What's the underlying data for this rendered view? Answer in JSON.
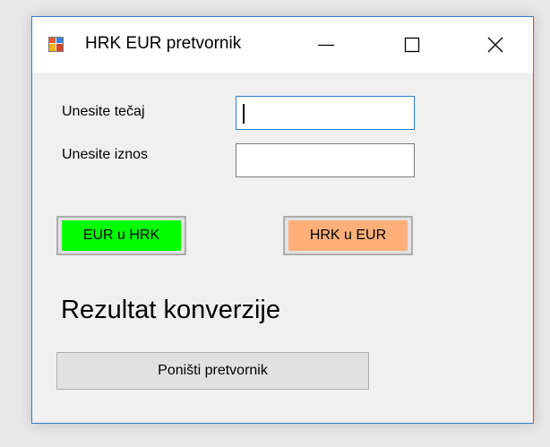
{
  "window": {
    "title": "HRK EUR pretvornik",
    "icon": "winforms-app-icon",
    "controls": {
      "minimize_icon": "minimize-icon",
      "maximize_icon": "maximize-icon",
      "close_icon": "close-icon"
    }
  },
  "form": {
    "rate_label": "Unesite tečaj",
    "rate_value": "",
    "amount_label": "Unesite iznos",
    "amount_value": ""
  },
  "buttons": {
    "eur_to_hrk": "EUR u HRK",
    "hrk_to_eur": "HRK u EUR",
    "reset": "Poništi pretvornik"
  },
  "result": {
    "text": "Rezultat konverzije"
  },
  "colors": {
    "eur_to_hrk_fill": "#00ff00",
    "hrk_to_eur_fill": "#ffb07a",
    "window_border": "#2f7fd1",
    "focus_border": "#2f7fd1"
  }
}
